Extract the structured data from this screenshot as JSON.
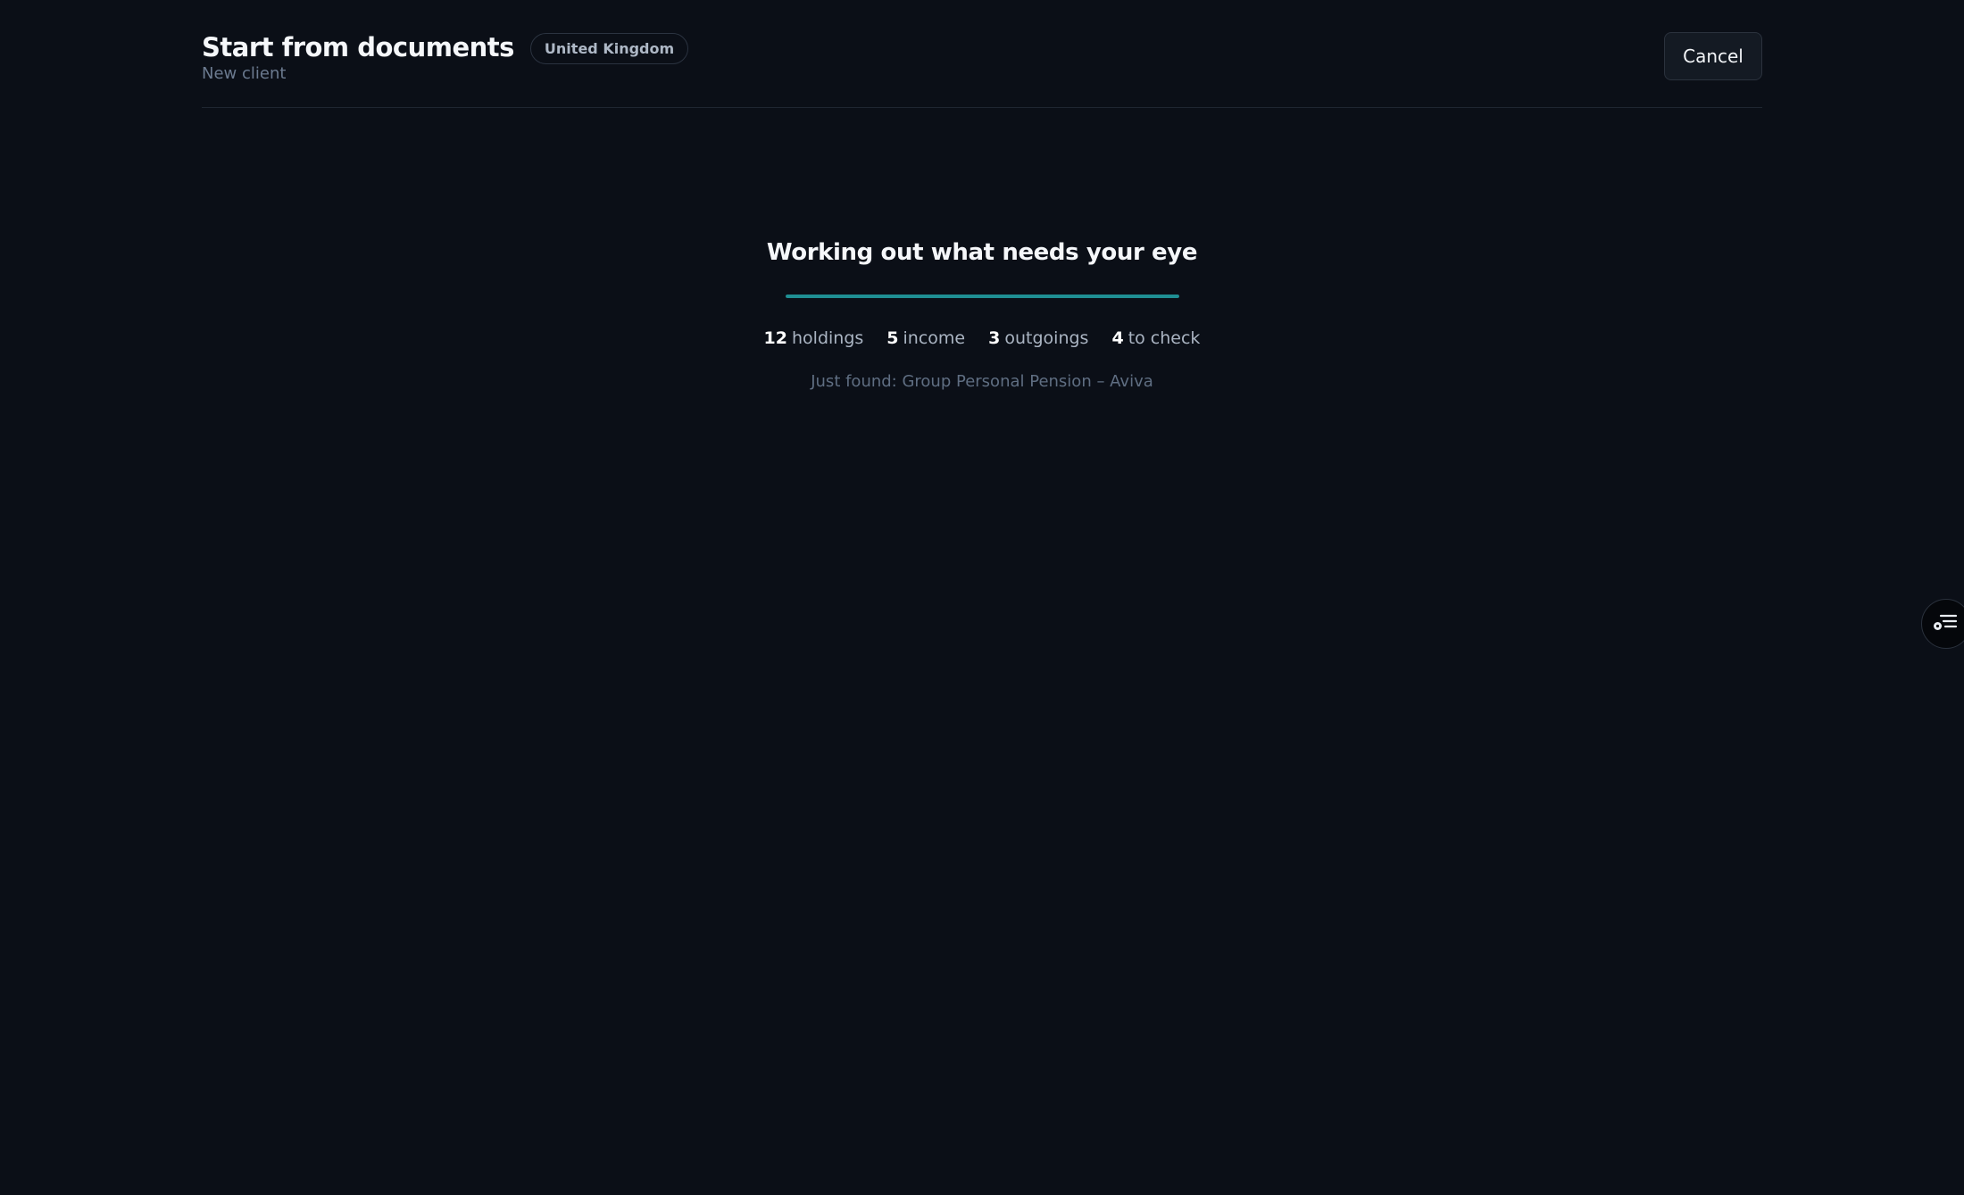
{
  "header": {
    "title": "Start from documents",
    "subtitle": "New client",
    "country": "United Kingdom",
    "cancel_label": "Cancel"
  },
  "status": {
    "heading": "Working out what needs your eye",
    "progress_percent": 100,
    "just_found": "Just found: Group Personal Pension – Aviva"
  },
  "stats": [
    {
      "count": "12",
      "label": "holdings"
    },
    {
      "count": "5",
      "label": "income"
    },
    {
      "count": "3",
      "label": "outgoings"
    },
    {
      "count": "4",
      "label": "to check"
    }
  ],
  "side_button": {
    "icon": "list-settings-icon"
  },
  "colors": {
    "background": "#0b0f17",
    "accent": "#1f8f93"
  }
}
